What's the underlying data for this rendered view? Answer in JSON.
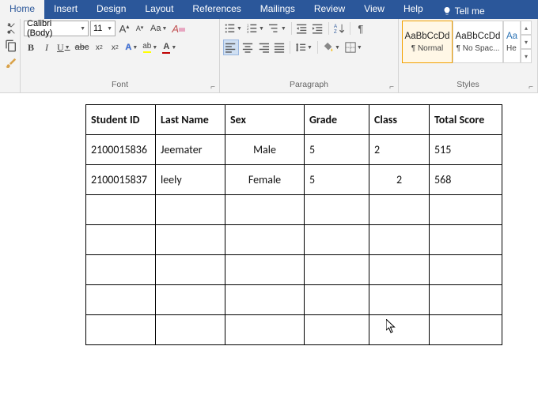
{
  "tabs": {
    "home": "Home",
    "insert": "Insert",
    "design": "Design",
    "layout": "Layout",
    "references": "References",
    "mailings": "Mailings",
    "review": "Review",
    "view": "View",
    "help": "Help",
    "tellme": "Tell me"
  },
  "ribbon": {
    "font": {
      "name": "Calibri (Body)",
      "size": "11",
      "label": "Font"
    },
    "paragraph": {
      "label": "Paragraph"
    },
    "styles": {
      "label": "Styles",
      "preview": "AaBbCcDd",
      "preview2": "AaBbCcDd",
      "preview3": "Aa",
      "n1": "¶ Normal",
      "n2": "¶ No Spac...",
      "n3": "He"
    }
  },
  "table": {
    "headers": [
      "Student ID",
      "Last Name",
      "Sex",
      "Grade",
      "Class",
      "Total Score"
    ],
    "rows": [
      [
        "2100015836",
        "Jeemater",
        "Male",
        "5",
        "2",
        "515"
      ],
      [
        "2100015837",
        "leely",
        "Female",
        "5",
        "2",
        "568"
      ],
      [
        "",
        "",
        "",
        "",
        "",
        ""
      ],
      [
        "",
        "",
        "",
        "",
        "",
        ""
      ],
      [
        "",
        "",
        "",
        "",
        "",
        ""
      ],
      [
        "",
        "",
        "",
        "",
        "",
        ""
      ],
      [
        "",
        "",
        "",
        "",
        "",
        ""
      ]
    ]
  }
}
